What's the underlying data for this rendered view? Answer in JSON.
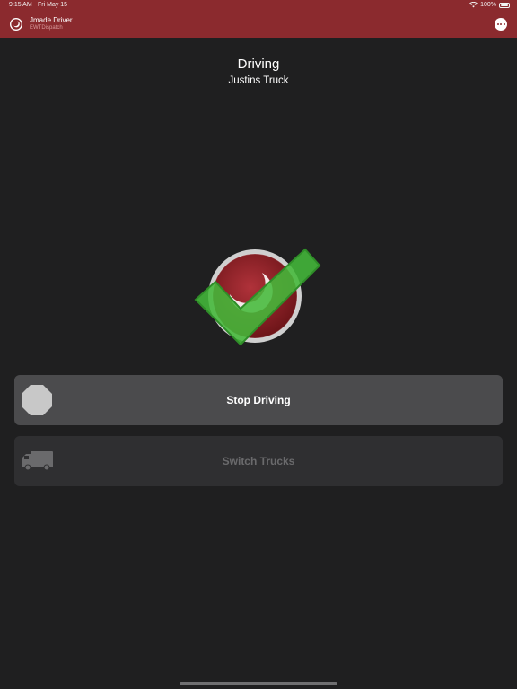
{
  "status_bar": {
    "time": "9:15 AM",
    "date": "Fri May 15",
    "battery": "100%"
  },
  "app_header": {
    "title": "Jmade Driver",
    "subtitle": "EWTDispatch",
    "logo_icon": "app-logo-icon",
    "menu_icon": "more-horizontal-icon"
  },
  "driving_status": {
    "title": "Driving",
    "truck_name": "Justins Truck"
  },
  "actions": {
    "stop_driving": {
      "label": "Stop Driving",
      "icon": "stop-octagon-icon",
      "enabled": true
    },
    "switch_trucks": {
      "label": "Switch Trucks",
      "icon": "truck-icon",
      "enabled": false
    }
  },
  "colors": {
    "header_bg": "#8b2a2e",
    "background": "#1f1f20",
    "primary_button": "#4b4b4d",
    "disabled_button": "#2f2f31",
    "check_green": "#3fb23a"
  }
}
